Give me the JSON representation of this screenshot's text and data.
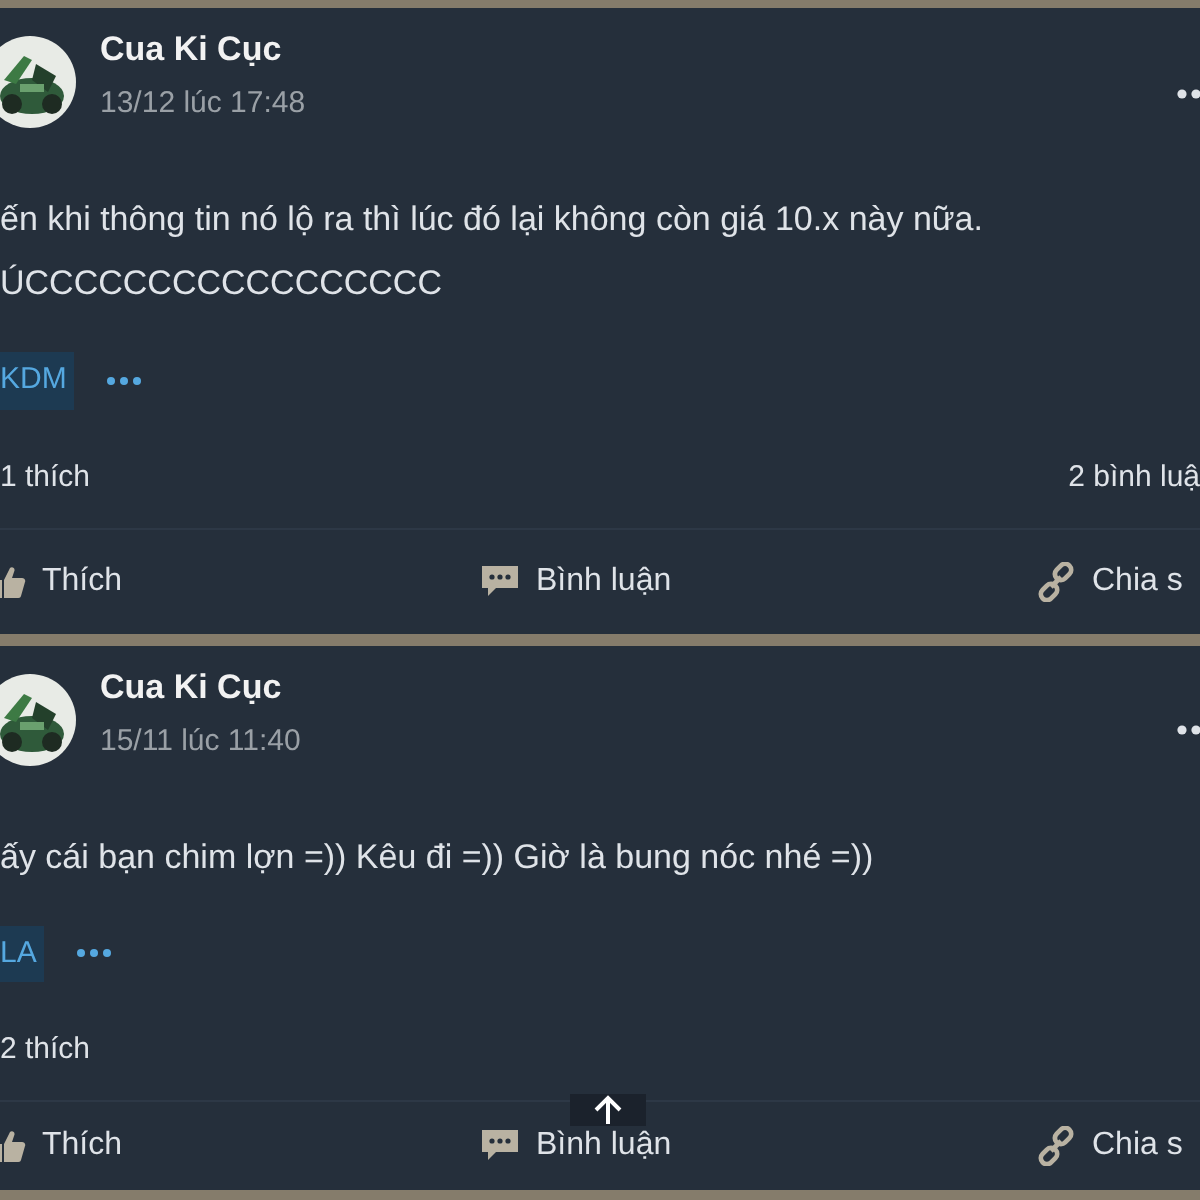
{
  "posts": [
    {
      "author": "Cua Ki Cục",
      "time": "13/12 lúc 17:48",
      "body": [
        "ến khi thông tin nó lộ ra thì lúc đó lại không còn giá 10.x này nữa.",
        "ÚCCCCCCCCCCCCCCCCC"
      ],
      "tag": "KDM",
      "likes": "1 thích",
      "comments": "2 bình luậ",
      "actions": [
        {
          "kind": "like",
          "label": "Thích"
        },
        {
          "kind": "comment",
          "label": "Bình luận"
        },
        {
          "kind": "share",
          "label": "Chia s"
        }
      ]
    },
    {
      "author": "Cua Ki Cục",
      "time": "15/11 lúc 11:40",
      "body": [
        "ấy cái bạn chim lợn =)) Kêu đi =)) Giờ là bung nóc nhé =))"
      ],
      "tag": "LA",
      "likes": "2 thích",
      "actions": [
        {
          "kind": "like",
          "label": "Thích"
        },
        {
          "kind": "comment",
          "label": "Bình luận"
        },
        {
          "kind": "share",
          "label": "Chia s"
        }
      ]
    }
  ]
}
